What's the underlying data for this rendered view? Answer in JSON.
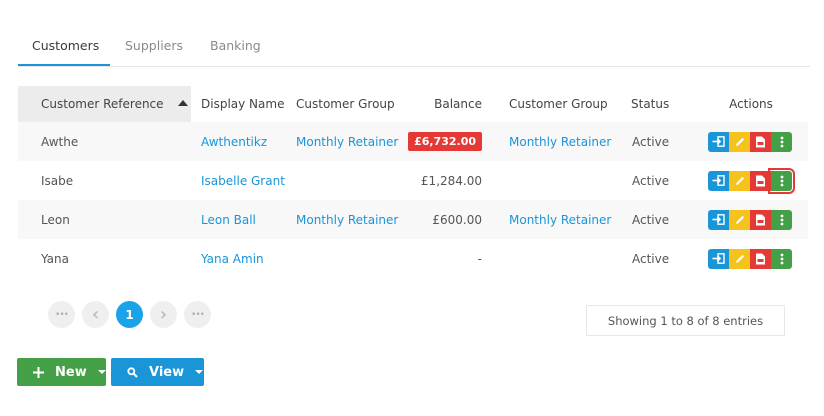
{
  "tabs": [
    {
      "label": "Customers",
      "active": true
    },
    {
      "label": "Suppliers",
      "active": false
    },
    {
      "label": "Banking",
      "active": false
    }
  ],
  "table": {
    "headers": {
      "reference": "Customer Reference",
      "display_name": "Display Name",
      "customer_group": "Customer Group",
      "balance": "Balance",
      "customer_group_2": "Customer Group",
      "status": "Status",
      "actions": "Actions"
    },
    "rows": [
      {
        "reference": "Awthe",
        "display_name": "Awthentikz",
        "customer_group": "Monthly Retainer",
        "balance": "£6,732.00",
        "balance_overdue": true,
        "customer_group_2": "Monthly Retainer",
        "status": "Active"
      },
      {
        "reference": "Isabe",
        "display_name": "Isabelle Grant",
        "customer_group": "",
        "balance": "£1,284.00",
        "balance_overdue": false,
        "customer_group_2": "",
        "status": "Active"
      },
      {
        "reference": "Leon",
        "display_name": "Leon Ball",
        "customer_group": "Monthly Retainer",
        "balance": "£600.00",
        "balance_overdue": false,
        "customer_group_2": "Monthly Retainer",
        "status": "Active"
      },
      {
        "reference": "Yana",
        "display_name": "Yana Amin",
        "customer_group": "",
        "balance": "-",
        "balance_overdue": false,
        "customer_group_2": "",
        "status": "Active"
      }
    ]
  },
  "pagination": {
    "first": "•••",
    "prev": "‹",
    "current": "1",
    "next": "›",
    "last": "•••"
  },
  "entries_text": "Showing 1 to 8 of 8 entries",
  "buttons": {
    "new_label": "New",
    "view_label": "View"
  },
  "colors": {
    "accent": "#1a95d8",
    "green": "#43a047",
    "yellow": "#f6c21c",
    "red": "#e53935"
  },
  "icons": {
    "new_button": "plus-icon",
    "view_button": "search-icon",
    "row_actions": [
      "login-icon",
      "pencil-icon",
      "pdf-icon",
      "more-vertical-icon"
    ]
  }
}
